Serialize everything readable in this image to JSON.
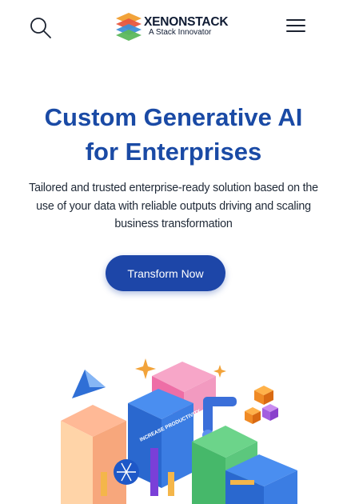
{
  "header": {
    "logo_name": "XENONSTACK",
    "logo_tagline": "A Stack Innovator",
    "search_icon": "search-icon",
    "menu_icon": "hamburger-menu-icon"
  },
  "hero": {
    "title_line1": "Custom Generative AI",
    "title_line2": "for Enterprises",
    "subtitle": "Tailored and trusted enterprise-ready solution based on the use of your data with reliable outputs driving and scaling business transformation",
    "cta_label": "Transform Now"
  },
  "illustration": {
    "badge_text": "INCREASE PRODUCTIVITY"
  },
  "colors": {
    "accent": "#1a4aa5",
    "button": "#1d46a8"
  }
}
